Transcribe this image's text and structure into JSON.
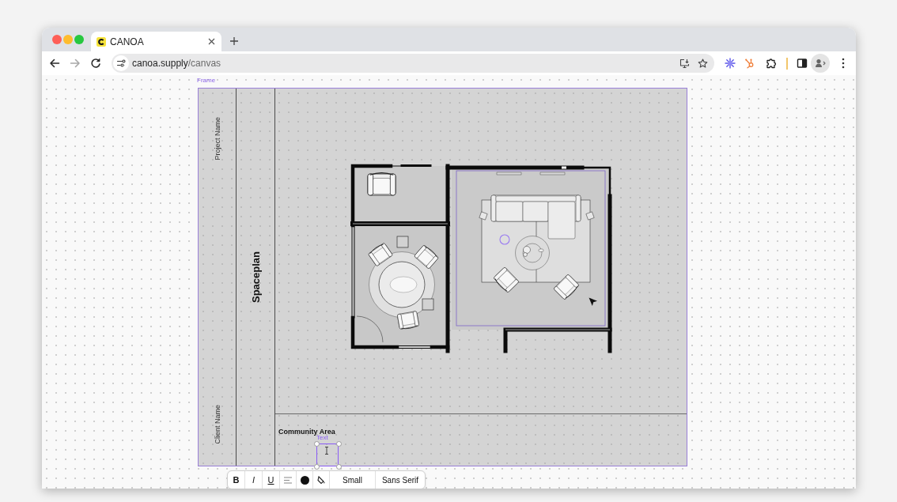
{
  "browser": {
    "tabs": [
      {
        "title": "CANOA",
        "selected": true
      }
    ],
    "nav_buttons": [
      {
        "kind": "back",
        "disabled": false
      },
      {
        "kind": "forward",
        "disabled": true
      },
      {
        "kind": "reload",
        "disabled": false
      }
    ],
    "address": {
      "host": "canoa.supply",
      "path": "/canvas"
    }
  },
  "canvas": {
    "frame": {
      "label": "Frame",
      "project_name": "Project Name",
      "sheet_title": "Spaceplan",
      "client_name": "Client Name",
      "area_label": "Community Area",
      "text_box": {
        "label": "Text",
        "selected": true
      }
    }
  },
  "text_toolbar": {
    "format_buttons": [
      {
        "label": "B",
        "kind": "bold"
      },
      {
        "label": "I",
        "kind": "italic"
      },
      {
        "label": "U",
        "kind": "underline"
      }
    ],
    "font_size": "Small",
    "font_family": "Sans Serif"
  }
}
